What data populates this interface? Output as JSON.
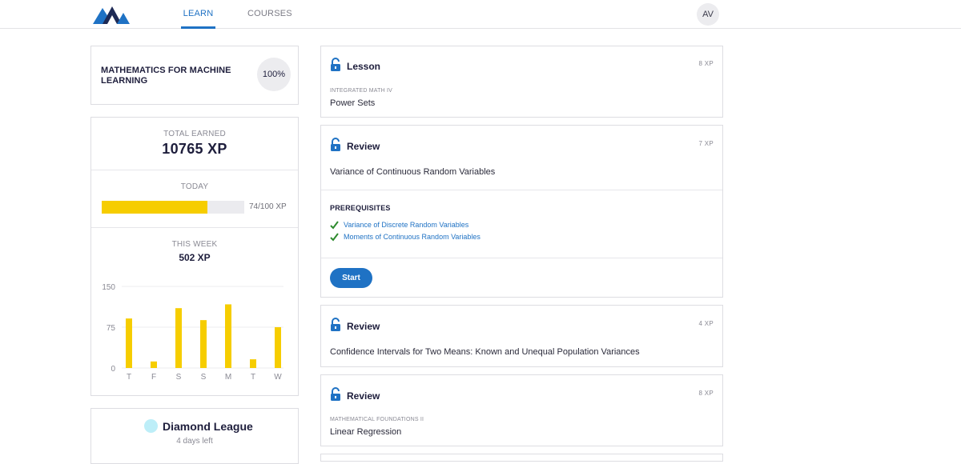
{
  "nav": {
    "tabs": [
      {
        "label": "LEARN",
        "active": true
      },
      {
        "label": "COURSES",
        "active": false
      }
    ],
    "avatar_initials": "AV",
    "accent": "#1f72c4"
  },
  "course": {
    "title": "MATHEMATICS FOR MACHINE LEARNING",
    "progress": "100%"
  },
  "xp": {
    "total_label": "TOTAL EARNED",
    "total": "10765 XP",
    "today_label": "TODAY",
    "today_progress_text": "74/100 XP",
    "today_fraction": 0.74,
    "week_label": "THIS WEEK",
    "week_total": "502 XP",
    "bar_color": "#f6cd00"
  },
  "chart_data": {
    "type": "bar",
    "categories": [
      "T",
      "F",
      "S",
      "S",
      "M",
      "T",
      "W"
    ],
    "values": [
      91,
      12,
      110,
      88,
      117,
      16,
      75
    ],
    "yticks": [
      "150",
      "75",
      "0"
    ],
    "ylim": [
      0,
      150
    ],
    "grid": true
  },
  "league": {
    "name": "Diamond League",
    "time_left": "4 days left"
  },
  "tasks": [
    {
      "type": "Lesson",
      "xp": "8 XP",
      "course": "INTEGRATED MATH IV",
      "title": "Power Sets"
    },
    {
      "type": "Review",
      "xp": "7 XP",
      "course": "",
      "title": "Variance of Continuous Random Variables",
      "prereq_heading": "PREREQUISITES",
      "prereqs": [
        "Variance of Discrete Random Variables",
        "Moments of Continuous Random Variables"
      ],
      "button": "Start"
    },
    {
      "type": "Review",
      "xp": "4 XP",
      "course": "",
      "title": "Confidence Intervals for Two Means: Known and Unequal Population Variances"
    },
    {
      "type": "Review",
      "xp": "8 XP",
      "course": "MATHEMATICAL FOUNDATIONS II",
      "title": "Linear Regression"
    }
  ]
}
